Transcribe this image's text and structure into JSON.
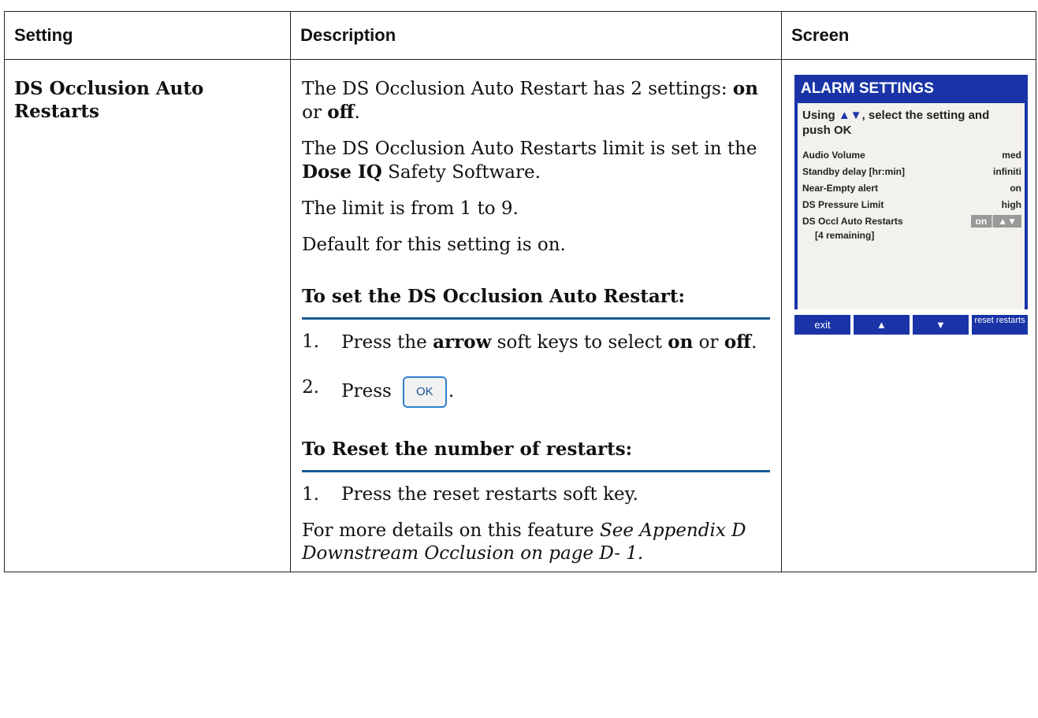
{
  "table": {
    "headers": [
      "Setting",
      "Description",
      "Screen"
    ]
  },
  "setting_name": "DS Occlusion Auto Restarts",
  "description": {
    "p1_a": "The DS Occlusion Auto Restart has 2 settings: ",
    "p1_on": "on",
    "p1_or": " or ",
    "p1_off": "off",
    "p1_end": ".",
    "p2_a": "The DS Occlusion Auto Restarts limit is set in the ",
    "p2_b": "Dose IQ",
    "p2_c": " Safety Software.",
    "p3": "The limit is from 1 to 9.",
    "p4": "Default for this setting is on.",
    "section1_title": "To set the DS Occlusion Auto Restart:",
    "step1_num": "1.",
    "step1_a": "Press the ",
    "step1_b": "arrow",
    "step1_c": " soft keys to select ",
    "step1_d": "on",
    "step1_e": " or ",
    "step1_f": "off",
    "step1_g": ".",
    "step2_num": "2.",
    "step2_a": "Press",
    "step2_key": "OK",
    "step2_end": ".",
    "section2_title": "To Reset the number of restarts:",
    "step3_num": "1.",
    "step3": "Press the reset restarts soft key.",
    "more_a": "For more details on this feature ",
    "more_b": "See Appendix D Downstream Occlusion on page D- 1."
  },
  "screen": {
    "title": "ALARM SETTINGS",
    "instr_a": "Using ",
    "instr_arrows": "▲▼",
    "instr_b": ", select the setting and push OK",
    "rows": [
      {
        "label": "Audio Volume",
        "value": "med"
      },
      {
        "label": "Standby delay [hr:min]",
        "value": "infiniti"
      },
      {
        "label": "Near-Empty alert",
        "value": "on"
      },
      {
        "label": "DS Pressure Limit",
        "value": "high"
      },
      {
        "label": "DS Occl Auto Restarts",
        "value": "on"
      }
    ],
    "remaining": "[4 remaining]",
    "toggle_arrows": "▲▼",
    "keys": [
      "exit",
      "▲",
      "▼",
      "reset restarts"
    ]
  }
}
